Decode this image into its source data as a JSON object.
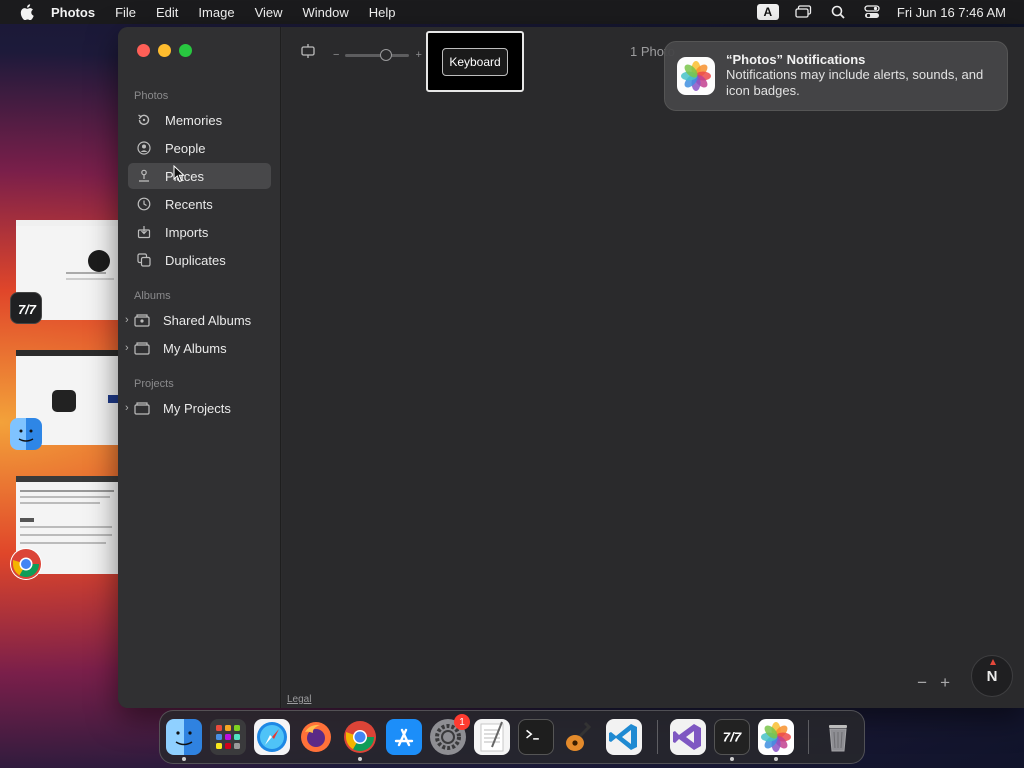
{
  "menubar": {
    "app_name": "Photos",
    "menus": [
      "File",
      "Edit",
      "Image",
      "View",
      "Window",
      "Help"
    ],
    "input_source": "A",
    "datetime": "Fri Jun 16  7:46 AM"
  },
  "sidebar": {
    "photos_header": "Photos",
    "photos_items": [
      {
        "label": "Memories",
        "icon": "memories-icon"
      },
      {
        "label": "People",
        "icon": "people-icon"
      },
      {
        "label": "Places",
        "icon": "places-icon",
        "selected": true
      },
      {
        "label": "Recents",
        "icon": "recents-icon"
      },
      {
        "label": "Imports",
        "icon": "imports-icon"
      },
      {
        "label": "Duplicates",
        "icon": "duplicates-icon"
      }
    ],
    "albums_header": "Albums",
    "album_items": [
      {
        "label": "Shared Albums",
        "icon": "shared-albums-icon"
      },
      {
        "label": "My Albums",
        "icon": "folder-icon"
      }
    ],
    "projects_header": "Projects",
    "project_items": [
      {
        "label": "My Projects",
        "icon": "folder-icon"
      }
    ]
  },
  "toolbar": {
    "zoom_minus": "−",
    "zoom_plus": "+",
    "photo_count": "1 Photo"
  },
  "tooltip": {
    "label": "Keyboard"
  },
  "notification": {
    "title": "“Photos” Notifications",
    "body": "Notifications may include alerts, sounds, and icon badges."
  },
  "map": {
    "legal": "Legal",
    "zoom_out": "−",
    "zoom_in": "+",
    "compass_label": "N"
  },
  "dock": {
    "settings_badge": "1",
    "apps": [
      "Finder",
      "Launchpad",
      "Safari",
      "Firefox",
      "Chrome",
      "App Store",
      "System Settings",
      "TextEdit",
      "Terminal",
      "GarageBand",
      "VS Code",
      "Visual Studio",
      "Remote App",
      "Photos",
      "Trash"
    ]
  },
  "colors": {
    "accent_red": "#fe5f57",
    "accent_yellow": "#febc2e",
    "accent_green": "#28c840",
    "badge_red": "#ff3b30"
  }
}
